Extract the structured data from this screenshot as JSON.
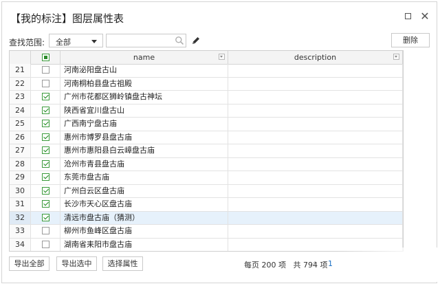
{
  "window": {
    "title": "【我的标注】图层属性表"
  },
  "toolbar": {
    "scope_label": "查找范围:",
    "scope_value": "全部",
    "search_placeholder": "",
    "delete_label": "删除"
  },
  "table": {
    "headers": {
      "name": "name",
      "description": "description"
    },
    "rows": [
      {
        "num": "21",
        "checked": false,
        "name": "河南泌阳盘古山",
        "description": "",
        "selected": false
      },
      {
        "num": "22",
        "checked": false,
        "name": "河南桐柏县盘古祖殿",
        "description": "",
        "selected": false
      },
      {
        "num": "23",
        "checked": true,
        "name": "广州市花都区狮岭镇盘古神坛",
        "description": "",
        "selected": false
      },
      {
        "num": "24",
        "checked": true,
        "name": "陕西省宜川盘古山",
        "description": "",
        "selected": false
      },
      {
        "num": "25",
        "checked": true,
        "name": "广西南宁盘古庙",
        "description": "",
        "selected": false
      },
      {
        "num": "26",
        "checked": true,
        "name": "惠州市博罗县盘古庙",
        "description": "",
        "selected": false
      },
      {
        "num": "27",
        "checked": true,
        "name": "惠州市惠阳县白云嶂盘古庙",
        "description": "",
        "selected": false
      },
      {
        "num": "28",
        "checked": true,
        "name": "沧州市青县盘古庙",
        "description": "",
        "selected": false
      },
      {
        "num": "29",
        "checked": true,
        "name": "东莞市盘古庙",
        "description": "",
        "selected": false
      },
      {
        "num": "30",
        "checked": true,
        "name": "广州白云区盘古庙",
        "description": "",
        "selected": false
      },
      {
        "num": "31",
        "checked": true,
        "name": "长沙市天心区盘古庙",
        "description": "",
        "selected": false
      },
      {
        "num": "32",
        "checked": true,
        "name": "清远市盘古庙（猜测）",
        "description": "",
        "selected": true
      },
      {
        "num": "33",
        "checked": false,
        "name": "柳州市鱼峰区盘古庙",
        "description": "",
        "selected": false
      },
      {
        "num": "34",
        "checked": false,
        "name": "湖南省耒阳市盘古庙",
        "description": "",
        "selected": false
      }
    ]
  },
  "footer": {
    "export_all": "导出全部",
    "export_selected": "导出选中",
    "choose_attributes": "选择属性",
    "per_page": "每页 200 项",
    "total": "共 794 项",
    "page": "1"
  },
  "colors": {
    "check_green": "#1b8a1b",
    "selected_row": "#e6f1fb",
    "page_link": "#1a6fc4"
  }
}
